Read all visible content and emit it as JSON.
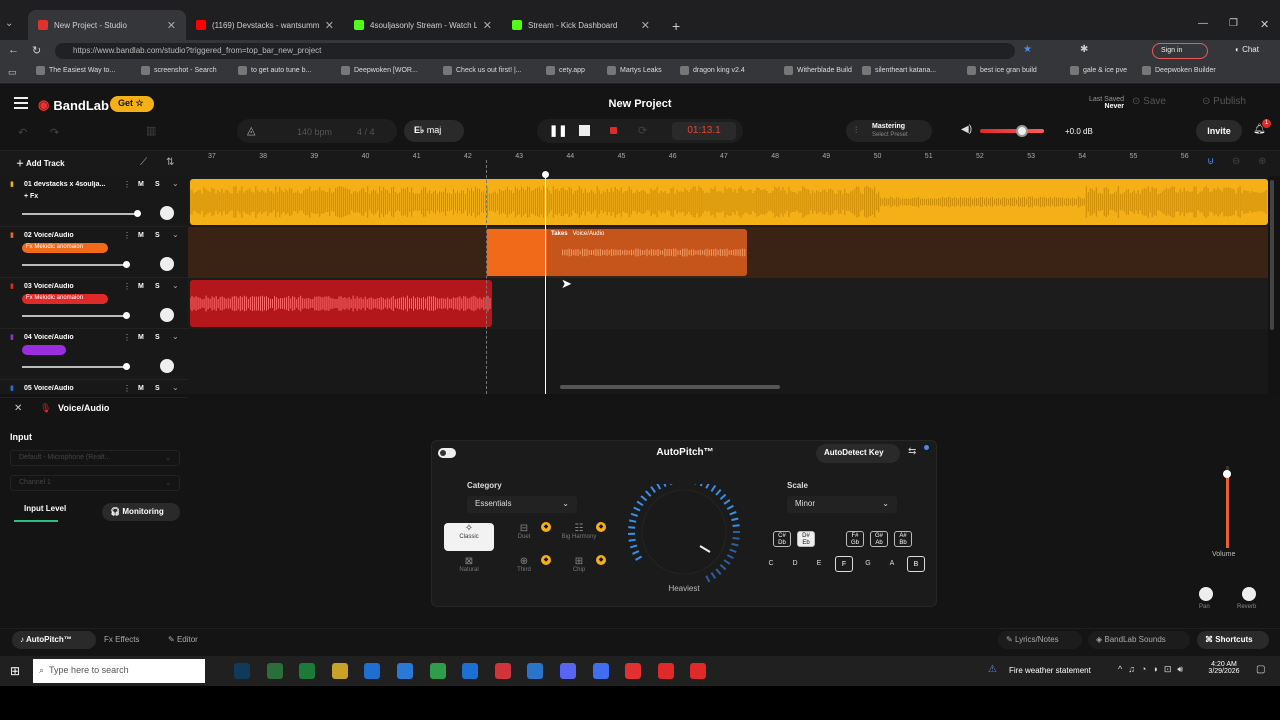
{
  "browser": {
    "tabs": [
      {
        "title": "New Project - Studio",
        "color": "#e0312d"
      },
      {
        "title": "(1169) Devstacks - wantsummore",
        "color": "#ff0000"
      },
      {
        "title": "4souljasonly Stream - Watch Live",
        "color": "#53fc18"
      },
      {
        "title": "Stream - Kick Dashboard",
        "color": "#53fc18"
      }
    ],
    "url": "https://www.bandlab.com/studio?triggered_from=top_bar_new_project",
    "sign_in": "Sign in",
    "chat": "Chat",
    "bookmarks": [
      "The Easiest Way to...",
      "screenshot - Search",
      "to get auto tune b...",
      "Deepwoken [WOR...",
      "Check us out first! |...",
      "cety.app",
      "Martys Leaks",
      "dragon king v2.4",
      "Witherblade Build",
      "silentheart katana...",
      "best ice gran build",
      "gale & ice pve",
      "Deepwoken Builder"
    ]
  },
  "header": {
    "logo": "BandLab",
    "get_label": "Get",
    "project_title": "New Project",
    "last_saved_label": "Last Saved",
    "last_saved_value": "Never",
    "save_label": "Save",
    "publish_label": "Publish",
    "bpm": "140 bpm",
    "time_sig": "4 / 4",
    "key": "maj",
    "time": "01:13.1",
    "mastering": "Mastering",
    "select_preset": "Select Preset",
    "volume_db": "+0.0 dB",
    "invite": "Invite",
    "notif_count": "1"
  },
  "timeline": {
    "add_track": "Add Track",
    "ruler": [
      "37",
      "38",
      "39",
      "40",
      "41",
      "42",
      "43",
      "44",
      "45",
      "46",
      "47",
      "48",
      "49",
      "50",
      "51",
      "52",
      "53",
      "54",
      "55",
      "56"
    ]
  },
  "tracks": [
    {
      "name": "01 devstacks x 4soulja...",
      "fx": "+ Fx",
      "color": "#f5b018"
    },
    {
      "name": "02 Voice/Audio",
      "fx": "Fx Melodic anomaion",
      "color": "#f06a1a"
    },
    {
      "name": "03 Voice/Audio",
      "fx": "Fx Melodic anomaion",
      "color": "#e02929"
    },
    {
      "name": "04 Voice/Audio",
      "fx": "",
      "color": "#9b2de0"
    },
    {
      "name": "05 Voice/Audio",
      "fx": "",
      "color": "#2d6be0"
    }
  ],
  "region": {
    "takes_label": "Takes",
    "takes_sub": "Voice/Audio"
  },
  "panel": {
    "track_title": "Voice/Audio",
    "input_label": "Input",
    "input_device": "Default - Microphone (Realt...",
    "channel": "Channel 1",
    "input_level": "Input Level",
    "monitoring": "Monitoring",
    "autopitch_title": "AutoPitch™",
    "autodetect": "AutoDetect Key",
    "category_label": "Category",
    "category_value": "Essentials",
    "scale_label": "Scale",
    "scale_value": "Minor",
    "effects": [
      {
        "label": "Classic",
        "active": true
      },
      {
        "label": "Duet",
        "active": false
      },
      {
        "label": "Big Harmony",
        "active": false
      },
      {
        "label": "Natural",
        "active": false
      },
      {
        "label": "Third",
        "active": false
      },
      {
        "label": "Chip",
        "active": false
      }
    ],
    "dial_label": "Heaviest",
    "accidentals": [
      "C# Db",
      "D# Eb",
      "F# Gb",
      "G# Ab",
      "A# Bb"
    ],
    "notes": [
      "C",
      "D",
      "E",
      "F",
      "G",
      "A",
      "B"
    ],
    "selected_notes": [
      "F",
      "B"
    ],
    "volume_label": "Volume",
    "pan_label": "Pan",
    "reverb_label": "Reverb",
    "bottom_tabs": [
      "AutoPitch™",
      "Effects",
      "Editor"
    ],
    "bottom_right": [
      "Lyrics/Notes",
      "BandLab Sounds",
      "Shortcuts"
    ]
  },
  "taskbar": {
    "search_placeholder": "Type here to search",
    "weather": "Fire weather statement",
    "clock_time": "4:20 AM",
    "clock_date": "3/29/2026"
  }
}
